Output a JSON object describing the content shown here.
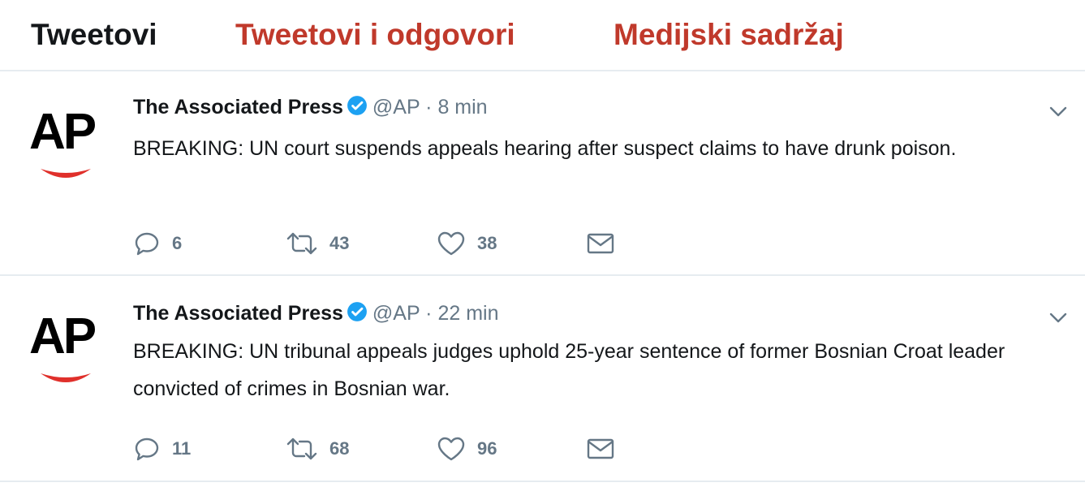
{
  "tabs": [
    {
      "label": "Tweetovi"
    },
    {
      "label": "Tweetovi i odgovori"
    },
    {
      "label": "Medijski sadržaj"
    }
  ],
  "accent_color": "#c0392b",
  "tweets": [
    {
      "avatar_text": "AP",
      "name": "The Associated Press",
      "handle": "@AP",
      "separator": "·",
      "time": "8 min",
      "text": "BREAKING: UN court suspends appeals hearing after suspect claims to have drunk poison.",
      "replies": "6",
      "retweets": "43",
      "likes": "38"
    },
    {
      "avatar_text": "AP",
      "name": "The Associated Press",
      "handle": "@AP",
      "separator": "·",
      "time": "22 min",
      "text": "BREAKING: UN tribunal appeals judges uphold 25-year sentence of former Bosnian Croat leader convicted of crimes in Bosnian war.",
      "replies": "11",
      "retweets": "68",
      "likes": "96"
    }
  ],
  "icons": [
    "verified-badge-icon",
    "chevron-down-icon",
    "reply-icon",
    "retweet-icon",
    "like-icon",
    "message-icon"
  ]
}
